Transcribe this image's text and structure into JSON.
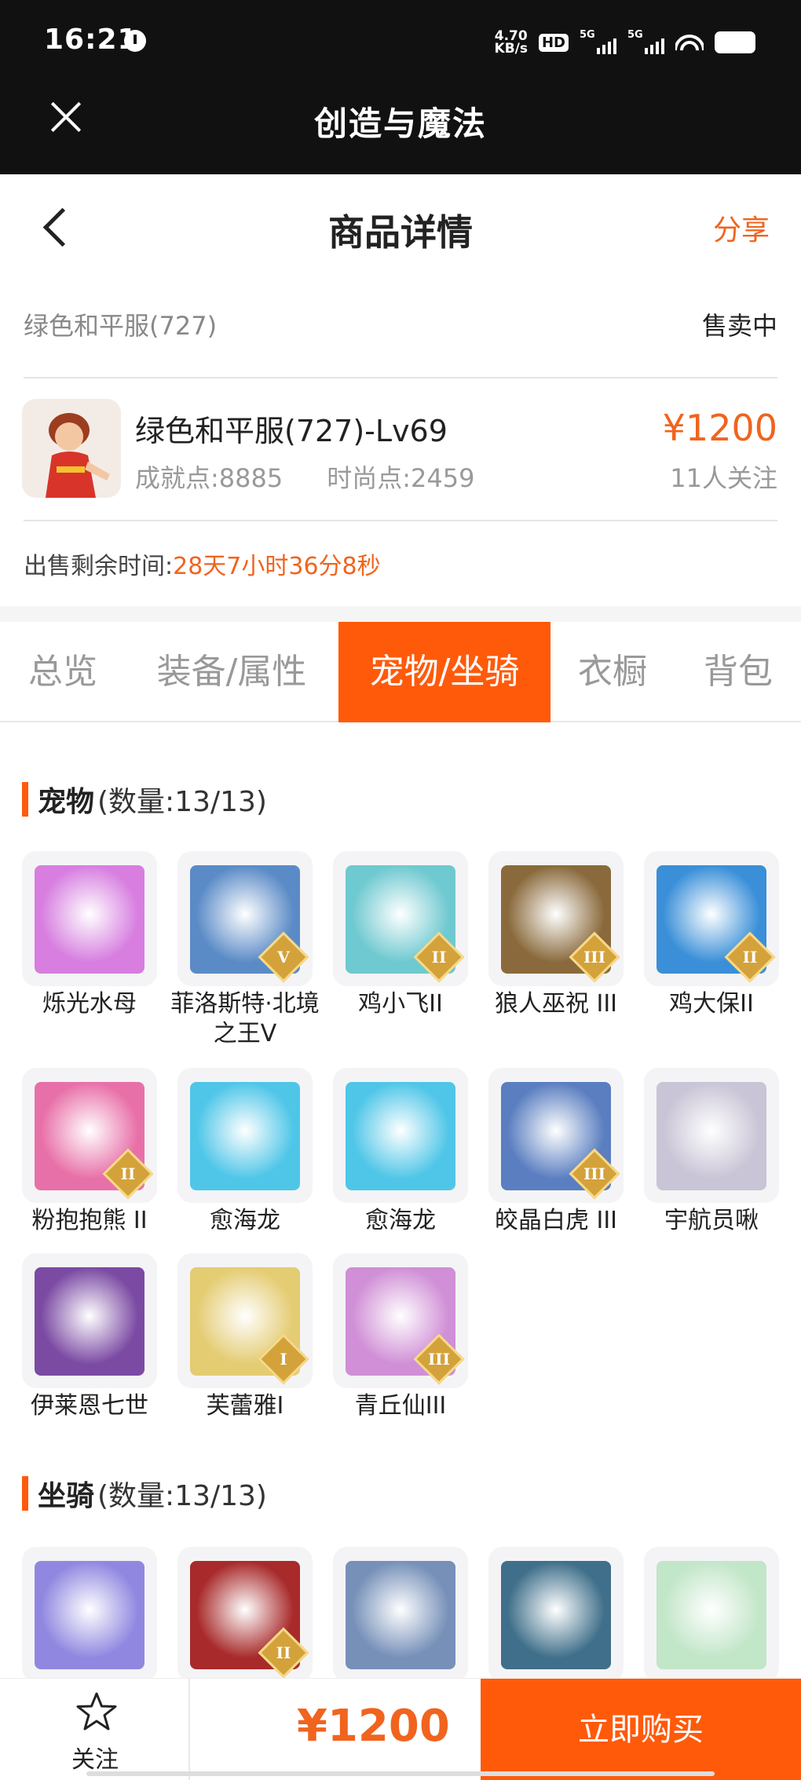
{
  "status_bar": {
    "time": "16:21",
    "net_speed_top": "4.70",
    "net_speed_bottom": "KB/s",
    "hd_label": "HD",
    "sim1_label": "5G",
    "sim2_label": "5G"
  },
  "app_bar": {
    "title": "创造与魔法"
  },
  "header": {
    "title": "商品详情",
    "share_label": "分享"
  },
  "summary": {
    "account_name": "绿色和平服(727)",
    "status": "售卖中",
    "product_name": "绿色和平服(727)-Lv69",
    "achievement": "成就点:8885",
    "fashion": "时尚点:2459",
    "price": "¥1200",
    "followers": "11人关注",
    "remaining_label": "出售剩余时间:",
    "remaining_value": "28天7小时36分8秒"
  },
  "tabs": [
    {
      "label": "总览",
      "active": false
    },
    {
      "label": "装备/属性",
      "active": false
    },
    {
      "label": "宠物/坐骑",
      "active": true
    },
    {
      "label": "衣橱",
      "active": false
    },
    {
      "label": "背包",
      "active": false
    }
  ],
  "pets_section": {
    "title": "宠物",
    "count": "(数量:13/13)",
    "items": [
      {
        "name": "烁光水母",
        "rank": "",
        "color": "#d77ee0"
      },
      {
        "name": "菲洛斯特·北境之王V",
        "rank": "V",
        "color": "#5b8bc7"
      },
      {
        "name": "鸡小飞II",
        "rank": "II",
        "color": "#6ec9d0"
      },
      {
        "name": "狼人巫祝 III",
        "rank": "III",
        "color": "#8a6a3c"
      },
      {
        "name": "鸡大保II",
        "rank": "II",
        "color": "#3a8fd8"
      },
      {
        "name": "粉抱抱熊 II",
        "rank": "II",
        "color": "#e870a8"
      },
      {
        "name": "愈海龙",
        "rank": "",
        "color": "#4fc6e8"
      },
      {
        "name": "愈海龙",
        "rank": "",
        "color": "#4fc6e8"
      },
      {
        "name": "皎晶白虎 III",
        "rank": "III",
        "color": "#5a7ec0"
      },
      {
        "name": "宇航员啾",
        "rank": "",
        "color": "#c9c4d6"
      },
      {
        "name": "伊莱恩七世",
        "rank": "",
        "color": "#7b4aa3"
      },
      {
        "name": "芙蕾雅I",
        "rank": "I",
        "color": "#e4cc72"
      },
      {
        "name": "青丘仙III",
        "rank": "III",
        "color": "#d08fd6"
      }
    ]
  },
  "mounts_section": {
    "title": "坐骑",
    "count": "(数量:13/13)",
    "items": [
      {
        "rank": "",
        "color": "#9088e0"
      },
      {
        "rank": "II",
        "color": "#a82a2a"
      },
      {
        "rank": "",
        "color": "#7690b8"
      },
      {
        "rank": "",
        "color": "#3f6f8a"
      },
      {
        "rank": "",
        "color": "#c2e6c8"
      }
    ]
  },
  "bottom_bar": {
    "follow_label": "关注",
    "price": "¥1200",
    "buy_label": "立即购买"
  }
}
